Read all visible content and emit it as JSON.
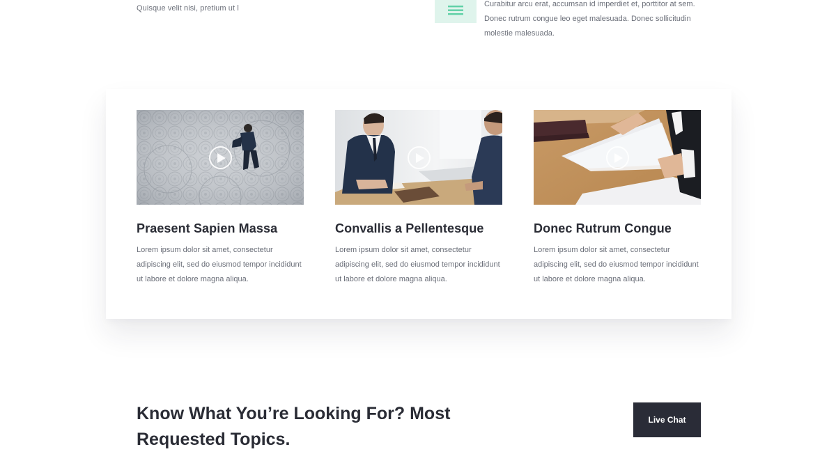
{
  "top": {
    "left_text": "Quisque velit nisi, pretium ut l",
    "right_icon": "list-icon",
    "right_text": "Curabitur arcu erat, accumsan id imperdiet et, porttitor at sem. Donec rutrum congue leo eget malesuada. Donec sollicitudin molestie malesuada."
  },
  "cards": [
    {
      "image": "businessman-walking-on-cobblestone",
      "icon": "play-icon",
      "title": "Praesent Sapien Massa",
      "text": "Lorem ipsum dolor sit amet, consectetur adipiscing elit, sed do eiusmod tempor incididunt ut labore et dolore magna aliqua."
    },
    {
      "image": "business-meeting-at-desk",
      "icon": "play-icon",
      "title": "Convallis a Pellentesque",
      "text": "Lorem ipsum dolor sit amet, consectetur adipiscing elit, sed do eiusmod tempor incididunt ut labore et dolore magna aliqua."
    },
    {
      "image": "hands-holding-documents",
      "icon": "play-icon",
      "title": "Donec Rutrum Congue",
      "text": "Lorem ipsum dolor sit amet, consectetur adipiscing elit, sed do eiusmod tempor incididunt ut labore et dolore magna aliqua."
    }
  ],
  "topics": {
    "heading": "Know What You’re Looking For? Most Requested Topics.",
    "button_label": "Live Chat"
  },
  "colors": {
    "heading": "#2a2c35",
    "body_text": "#6b6f79",
    "button_bg": "#2a2c37",
    "icon_tile": "#dff4ec",
    "icon_accent": "#5fd0a6"
  }
}
